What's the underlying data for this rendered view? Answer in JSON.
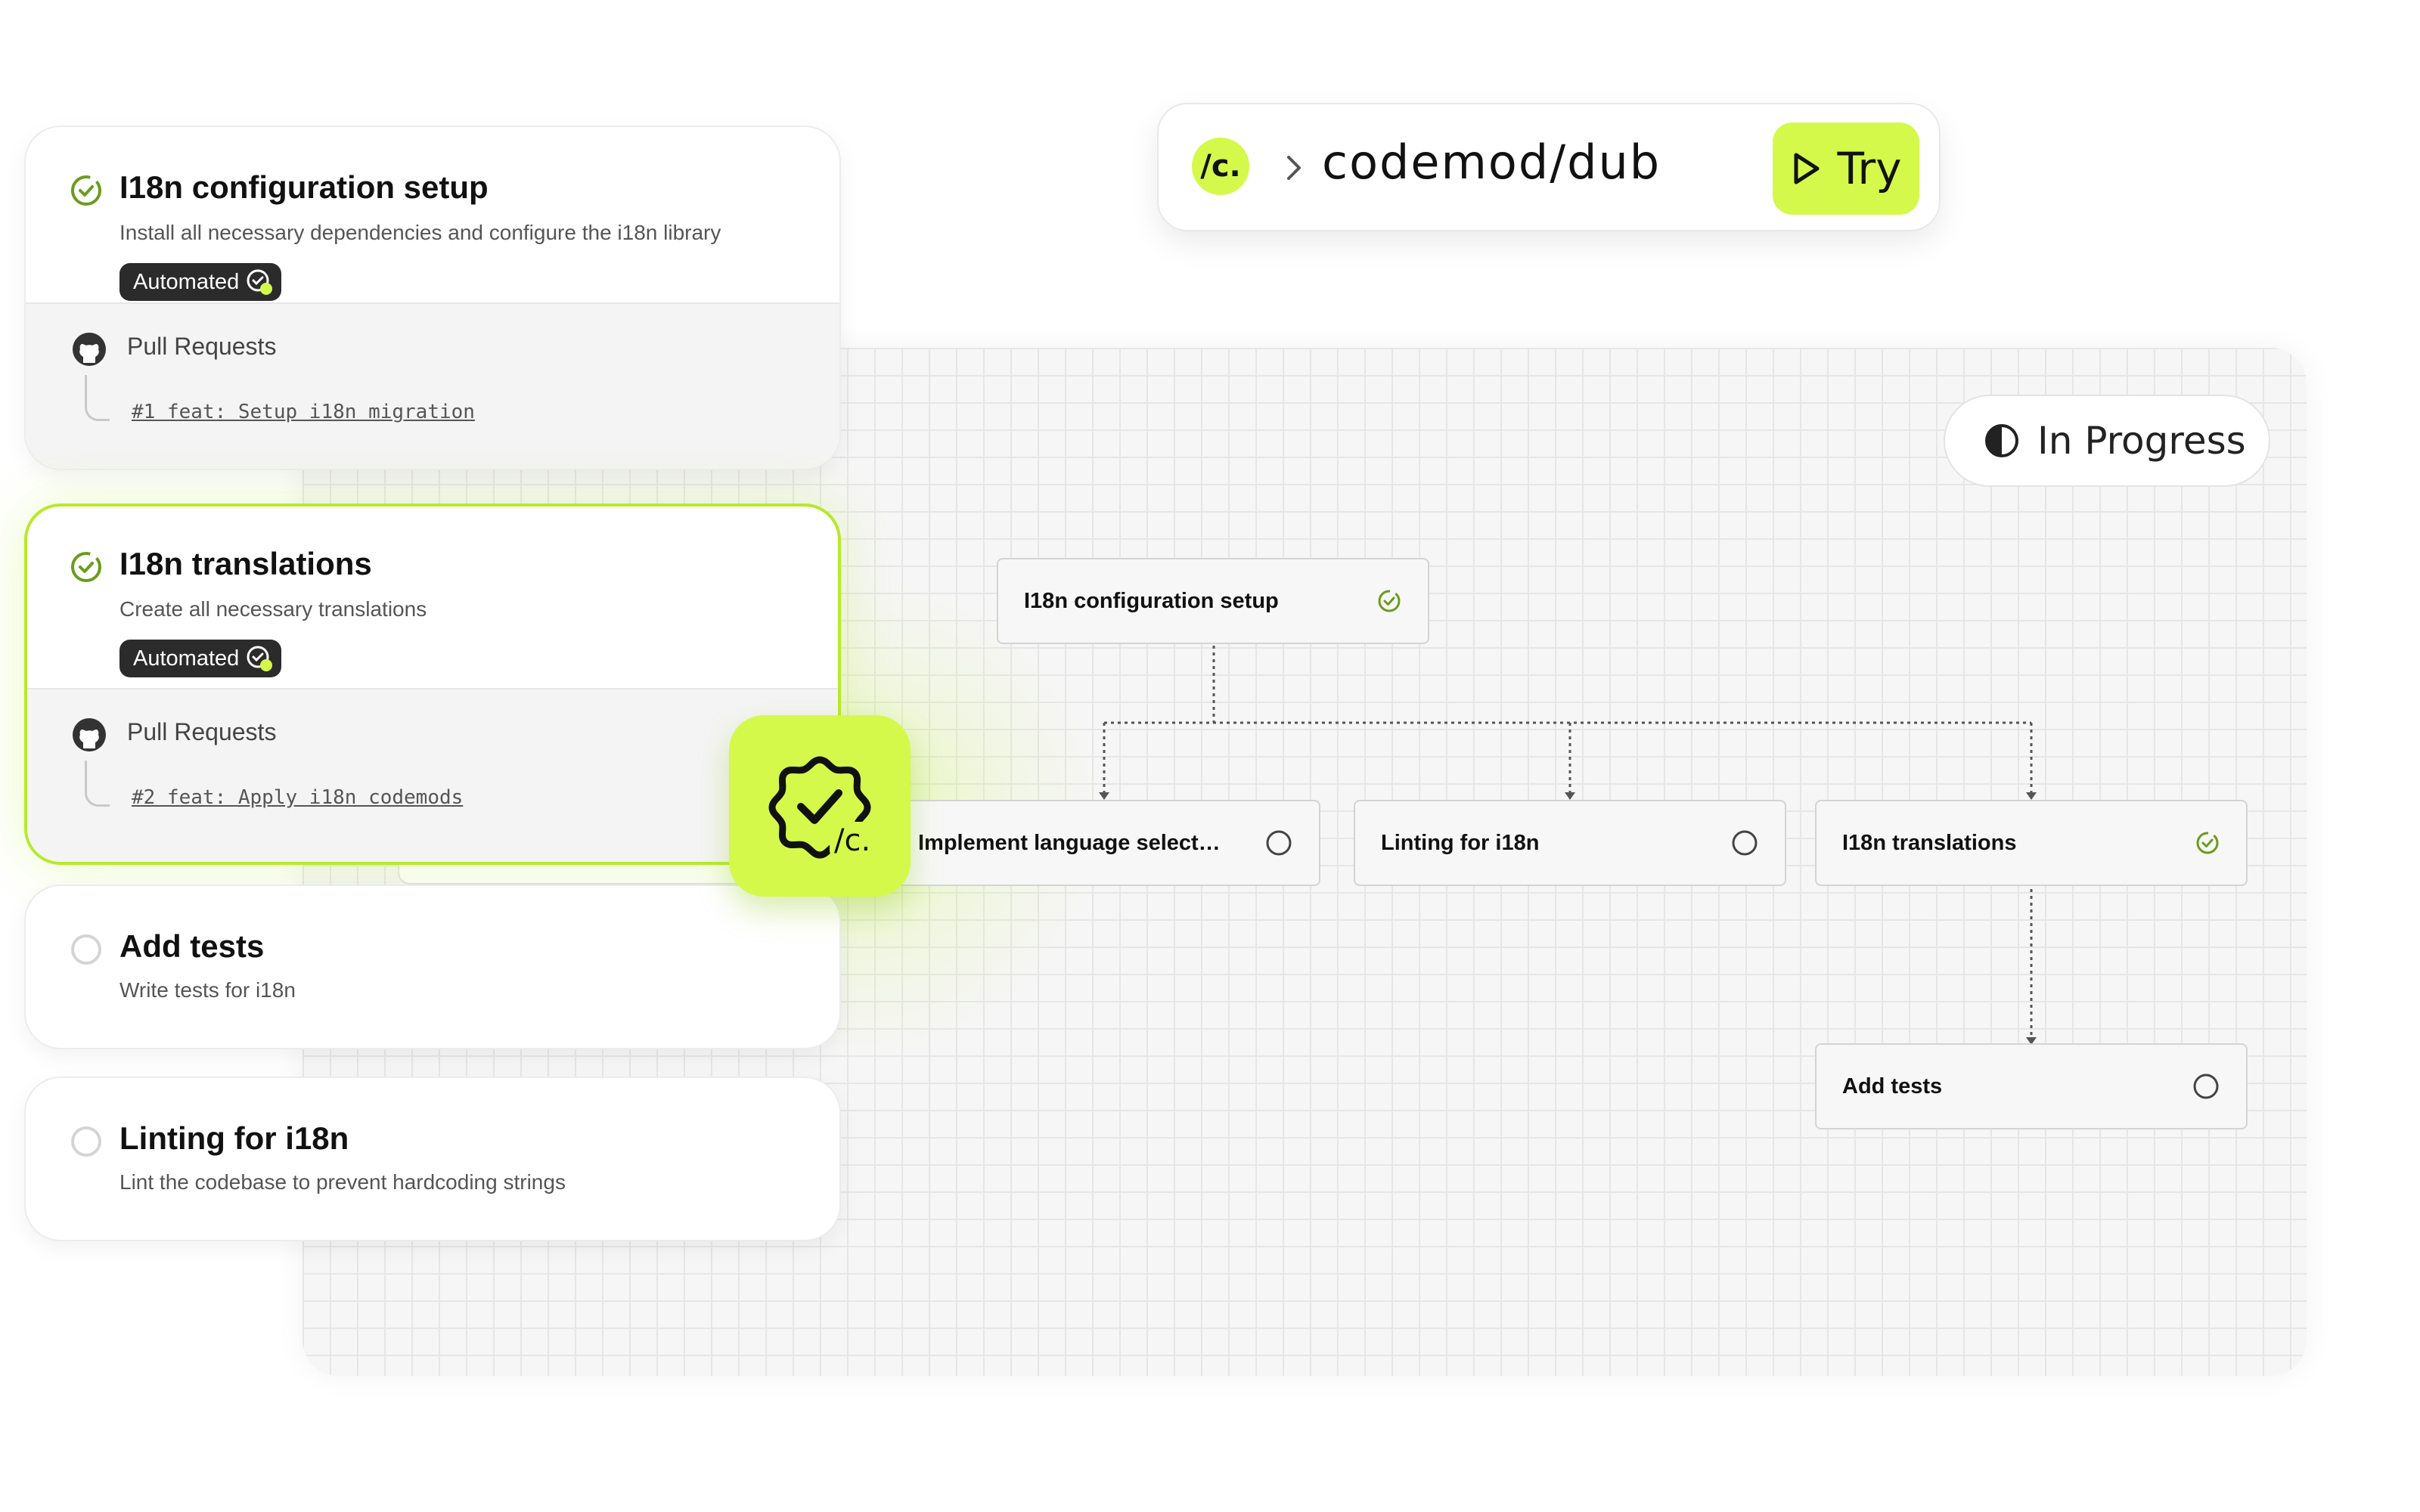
{
  "repo_bar": {
    "logo_text": "/c.",
    "path": "codemod/dub",
    "try_label": "Try",
    "logo_icon": "codemod-logo-icon",
    "chevron_icon": "chevron-right-icon",
    "play_icon": "play-icon"
  },
  "status": {
    "label": "In Progress",
    "icon": "half-circle-icon"
  },
  "colors": {
    "accent": "#d4f94a",
    "active_border": "#b6ea2a",
    "done_check": "#6a9c1c",
    "badge_bg": "#2b2b2b"
  },
  "tasks": [
    {
      "title": "I18n configuration setup",
      "description": "Install all necessary dependencies and configure the i18n library",
      "badge": "Automated",
      "status": "done",
      "pull_requests_label": "Pull Requests",
      "pr_link": "#1 feat: Setup i18n migration"
    },
    {
      "title": "I18n translations",
      "description": "Create all necessary translations",
      "badge": "Automated",
      "status": "done",
      "pull_requests_label": "Pull Requests",
      "pr_link": "#2 feat: Apply i18n codemods"
    },
    {
      "title": "Add tests",
      "description": "Write tests for i18n",
      "status": "pending"
    },
    {
      "title": "Linting for i18n",
      "description": "Lint the codebase to prevent hardcoding strings",
      "status": "pending"
    }
  ],
  "app_icon": {
    "text": "/c.",
    "icon": "verified-badge-icon"
  },
  "flow": {
    "nodes": [
      {
        "label": "I18n configuration setup",
        "status": "done"
      },
      {
        "label": "Implement language selection",
        "status": "pending"
      },
      {
        "label": "Linting for i18n",
        "status": "pending"
      },
      {
        "label": "I18n translations",
        "status": "done"
      },
      {
        "label": "Add tests",
        "status": "pending"
      }
    ]
  }
}
